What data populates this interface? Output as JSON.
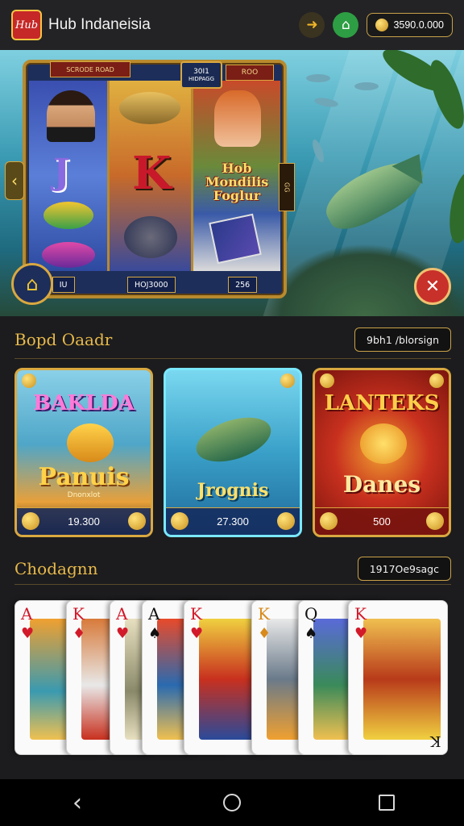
{
  "header": {
    "logo_text": "Hub",
    "title": "Hub Indaneisia",
    "balance": "3590.0.000",
    "icons": {
      "back": "back-arrow-icon",
      "gift": "gift-icon",
      "coin": "coin-icon"
    }
  },
  "hero": {
    "slot_title": "SCRODE ROAD",
    "center_tag_top": "30I1",
    "center_tag_bottom": "HIDPAGG",
    "right_tag": "ROO",
    "reel3_word": "Hob Mondilis Foglur",
    "side_tag": "GG",
    "foot_left": "IU",
    "foot_center": "HOJ3000",
    "foot_right": "256"
  },
  "section1": {
    "title": "Bopd Oaadr",
    "button_label": "9bh1 /blorsign",
    "tiles": [
      {
        "top": "BAKLDA",
        "mid": "Panuis",
        "sub": "Dnonxlot",
        "value": "19.300"
      },
      {
        "top": "",
        "mid": "Jrognis",
        "sub": "",
        "value": "27.300"
      },
      {
        "top": "LANTEKS",
        "mid": "Danes",
        "sub": "",
        "value": "500"
      }
    ]
  },
  "section2": {
    "title": "Chodagnn",
    "button_label": "1917Oe9sagc",
    "cards": [
      {
        "rank": "A",
        "suit": "♥",
        "color": "red"
      },
      {
        "rank": "K",
        "suit": "♦",
        "color": "red"
      },
      {
        "rank": "A",
        "suit": "♥",
        "color": "red"
      },
      {
        "rank": "A",
        "suit": "♠",
        "color": "black"
      },
      {
        "rank": "K",
        "suit": "♥",
        "color": "red"
      },
      {
        "rank": "K",
        "suit": "♦",
        "color": "red"
      },
      {
        "rank": "Q",
        "suit": "♠",
        "color": "black"
      },
      {
        "rank": "K",
        "suit": "♥",
        "color": "red"
      }
    ],
    "last_card_corner": "K"
  },
  "navbar": {
    "icons": [
      "back-nav-icon",
      "home-nav-icon",
      "recents-nav-icon"
    ]
  },
  "colors": {
    "background": "#1c1c1e",
    "accent_gold": "#e8b94a",
    "gift_green": "#2e9e44",
    "close_red": "#c8302a"
  }
}
